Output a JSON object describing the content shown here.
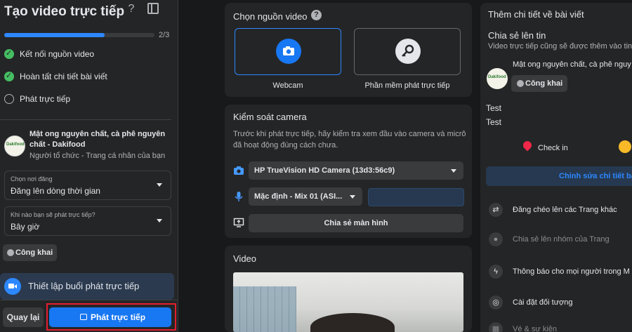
{
  "sidebar": {
    "title": "Tạo video trực tiếp",
    "progress": {
      "value": 0.67,
      "text": "2/3"
    },
    "steps": [
      {
        "label": "Kết nối nguồn video",
        "done": true
      },
      {
        "label": "Hoàn tất chi tiết bài viết",
        "done": true
      },
      {
        "label": "Phát trực tiếp",
        "done": false
      }
    ],
    "page": {
      "avatar_text": "Dakifood",
      "name": "Mật ong nguyên chất, cà phê nguyên chất - Dakifood",
      "role": "Người tổ chức - Trang cá nhân của bạn"
    },
    "post_location": {
      "label": "Chọn nơi đăng",
      "value": "Đăng lên dòng thời gian"
    },
    "schedule": {
      "label": "Khi nào bạn sẽ phát trực tiếp?",
      "value": "Bây giờ"
    },
    "audience": "Công khai",
    "setup": "Thiết lập buổi phát trực tiếp",
    "back": "Quay lại",
    "go_live": "Phát trực tiếp"
  },
  "source": {
    "title": "Chọn nguồn video",
    "options": [
      {
        "label": "Webcam",
        "icon": "camera-icon",
        "selected": true
      },
      {
        "label": "Phần mềm phát trực tiếp",
        "icon": "key-icon",
        "selected": false
      }
    ]
  },
  "camera": {
    "title": "Kiểm soát camera",
    "description": "Trước khi phát trực tiếp, hãy kiểm tra xem đầu vào camera và micrô đã hoạt động đúng cách chưa.",
    "camera_device": "HP TrueVision HD Camera (13d3:56c9)",
    "mic_device": "Mặc định - Mix 01 (ASI...",
    "share_screen": "Chia sẻ màn hình"
  },
  "video": {
    "title": "Video"
  },
  "details": {
    "title": "Thêm chi tiết về bài viết",
    "story_title": "Chia sẻ lên tin",
    "story_note": "Video trực tiếp cũng sẽ được thêm vào tin",
    "page_name": "Mật ong nguyên chất, cà phê nguy",
    "audience": "Công khai",
    "text_lines": [
      "Test",
      "Test"
    ],
    "checkin": "Check in",
    "edit_button": "Chỉnh sửa chi tiết bài",
    "items": [
      {
        "label": "Đăng chéo lên các Trang khác",
        "icon": "crosspost-icon",
        "enabled": true
      },
      {
        "label": "Chia sẻ lên nhóm của Trang",
        "icon": "group-icon",
        "enabled": false
      },
      {
        "label": "Thông báo cho mọi người trong M",
        "icon": "messenger-icon",
        "enabled": true
      },
      {
        "label": "Cài đặt đối tượng",
        "icon": "globe-icon",
        "enabled": true
      },
      {
        "label": "Vé & sự kiện",
        "icon": "ticket-icon",
        "enabled": false
      }
    ]
  },
  "colors": {
    "accent": "#1877f2",
    "highlight_border": "#e41e2e",
    "done": "#45bd62"
  }
}
